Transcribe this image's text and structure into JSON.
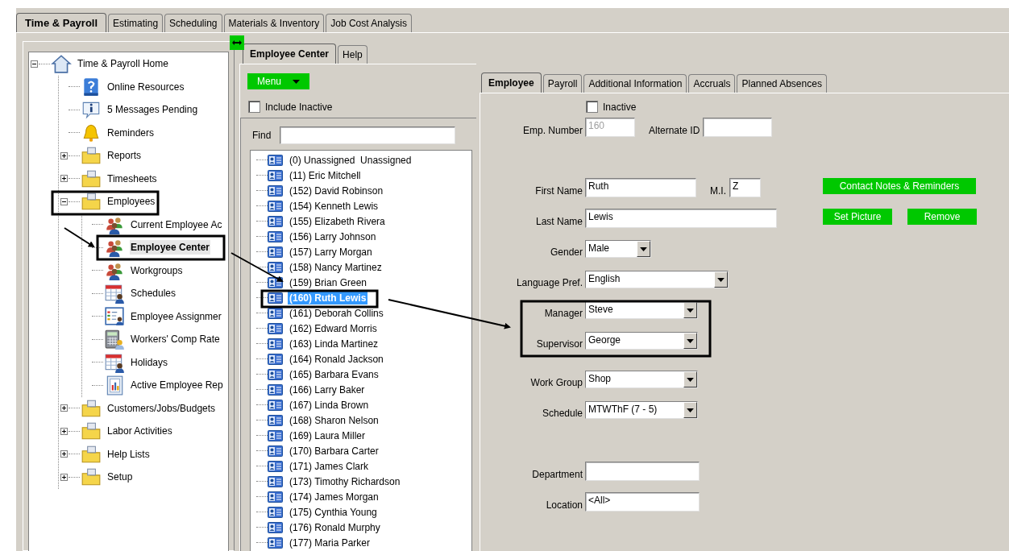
{
  "main_tabs": [
    {
      "label": "Time & Payroll",
      "selected": true
    },
    {
      "label": "Estimating",
      "selected": false
    },
    {
      "label": "Scheduling",
      "selected": false
    },
    {
      "label": "Materials & Inventory",
      "selected": false
    },
    {
      "label": "Job Cost Analysis",
      "selected": false
    }
  ],
  "nav_tree": [
    {
      "label": "Time & Payroll Home",
      "kind": "home",
      "expanded": true,
      "selected": false,
      "children": [
        {
          "label": "Online Resources",
          "kind": "help",
          "selected": false
        },
        {
          "label": "5 Messages Pending",
          "kind": "info",
          "selected": false
        },
        {
          "label": "Reminders",
          "kind": "bell",
          "selected": false
        },
        {
          "label": "Reports",
          "kind": "folder",
          "expanded": false,
          "selected": false
        },
        {
          "label": "Timesheets",
          "kind": "folder",
          "expanded": false,
          "selected": false
        },
        {
          "label": "Employees",
          "kind": "folder",
          "expanded": true,
          "selected": false,
          "children": [
            {
              "label": "Current Employee Ac",
              "kind": "people",
              "selected": false
            },
            {
              "label": "Employee Center",
              "kind": "people",
              "selected": true
            },
            {
              "label": "Workgroups",
              "kind": "people",
              "selected": false
            },
            {
              "label": "Schedules",
              "kind": "calendar",
              "selected": false
            },
            {
              "label": "Employee Assignmer",
              "kind": "list",
              "selected": false
            },
            {
              "label": "Workers' Comp Rate",
              "kind": "calculator",
              "selected": false
            },
            {
              "label": "Holidays",
              "kind": "calendar",
              "selected": false
            },
            {
              "label": "Active Employee Rep",
              "kind": "report",
              "selected": false
            }
          ]
        },
        {
          "label": "Customers/Jobs/Budgets",
          "kind": "folder",
          "expanded": false,
          "selected": false
        },
        {
          "label": "Labor Activities",
          "kind": "folder",
          "expanded": false,
          "selected": false
        },
        {
          "label": "Help Lists",
          "kind": "folder",
          "expanded": false,
          "selected": false
        },
        {
          "label": "Setup",
          "kind": "folder",
          "expanded": false,
          "selected": false
        }
      ]
    }
  ],
  "employee_center": {
    "tabs": [
      {
        "label": "Employee Center",
        "selected": true
      },
      {
        "label": "Help",
        "selected": false
      }
    ],
    "menu_button": "Menu",
    "include_inactive": {
      "label": "Include Inactive",
      "checked": false
    },
    "find": {
      "label": "Find"
    },
    "employees": [
      {
        "label": "(0) Unassigned  Unassigned",
        "selected": false
      },
      {
        "label": "(11) Eric Mitchell",
        "selected": false
      },
      {
        "label": "(152) David Robinson",
        "selected": false
      },
      {
        "label": "(154) Kenneth Lewis",
        "selected": false
      },
      {
        "label": "(155) Elizabeth Rivera",
        "selected": false
      },
      {
        "label": "(156) Larry Johnson",
        "selected": false
      },
      {
        "label": "(157) Larry Morgan",
        "selected": false
      },
      {
        "label": "(158) Nancy Martinez",
        "selected": false
      },
      {
        "label": "(159) Brian Green",
        "selected": false
      },
      {
        "label": "(160) Ruth Lewis",
        "selected": true
      },
      {
        "label": "(161) Deborah Collins",
        "selected": false
      },
      {
        "label": "(162) Edward Morris",
        "selected": false
      },
      {
        "label": "(163) Linda Martinez",
        "selected": false
      },
      {
        "label": "(164) Ronald Jackson",
        "selected": false
      },
      {
        "label": "(165) Barbara Evans",
        "selected": false
      },
      {
        "label": "(166) Larry Baker",
        "selected": false
      },
      {
        "label": "(167) Linda Brown",
        "selected": false
      },
      {
        "label": "(168) Sharon Nelson",
        "selected": false
      },
      {
        "label": "(169) Laura Miller",
        "selected": false
      },
      {
        "label": "(170) Barbara Carter",
        "selected": false
      },
      {
        "label": "(171) James Clark",
        "selected": false
      },
      {
        "label": "(173) Timothy Richardson",
        "selected": false
      },
      {
        "label": "(174) James Morgan",
        "selected": false
      },
      {
        "label": "(175) Cynthia Young",
        "selected": false
      },
      {
        "label": "(176) Ronald Murphy",
        "selected": false
      },
      {
        "label": "(177) Maria Parker",
        "selected": false
      }
    ]
  },
  "employee_form": {
    "tabs": [
      {
        "label": "Employee",
        "selected": true
      },
      {
        "label": "Payroll",
        "selected": false
      },
      {
        "label": "Additional Information",
        "selected": false
      },
      {
        "label": "Accruals",
        "selected": false
      },
      {
        "label": "Planned Absences",
        "selected": false
      }
    ],
    "inactive": {
      "label": "Inactive",
      "checked": false
    },
    "groups": [
      {
        "rows": [
          {
            "items": [
              {
                "kind": "text",
                "label": "Emp. Number",
                "value": "160",
                "disabled": true
              },
              {
                "kind": "text",
                "label": "Alternate ID"
              }
            ]
          }
        ]
      },
      {
        "rows": [
          {
            "items": [
              {
                "kind": "text",
                "label": "First Name",
                "value": "Ruth",
                "disabled": false
              },
              {
                "kind": "text",
                "label": "M.I.",
                "value": "Z",
                "disabled": false
              },
              {
                "kind": "button",
                "label": "Contact Notes & Reminders"
              }
            ]
          },
          {
            "items": [
              {
                "kind": "text",
                "label": "Last Name",
                "value": "Lewis",
                "disabled": false
              },
              {
                "kind": "button",
                "label": "Set Picture"
              },
              {
                "kind": "button",
                "label": "Remove"
              }
            ]
          },
          {
            "items": [
              {
                "kind": "select",
                "label": "Gender",
                "value": "Male",
                "disabled": false
              }
            ]
          },
          {
            "items": [
              {
                "kind": "select",
                "label": "Language Pref.",
                "value": "English",
                "disabled": false
              }
            ]
          }
        ]
      },
      {
        "rows": [
          {
            "items": [
              {
                "kind": "select",
                "label": "Manager",
                "value": "Steve",
                "disabled": false
              }
            ]
          },
          {
            "items": [
              {
                "kind": "select",
                "label": "Supervisor",
                "value": "George",
                "disabled": false
              }
            ]
          }
        ]
      },
      {
        "rows": [
          {
            "items": [
              {
                "kind": "select",
                "label": "Work Group",
                "value": "Shop",
                "disabled": false
              }
            ]
          },
          {
            "items": [
              {
                "kind": "select",
                "label": "Schedule",
                "value": "MTWThF (7 - 5)",
                "disabled": false
              }
            ]
          }
        ]
      },
      {
        "rows": [
          {
            "items": [
              {
                "kind": "text",
                "label": "Department"
              }
            ]
          },
          {
            "items": [
              {
                "kind": "text",
                "label": "Location",
                "value": "<All>",
                "disabled": false
              }
            ]
          }
        ]
      }
    ]
  }
}
